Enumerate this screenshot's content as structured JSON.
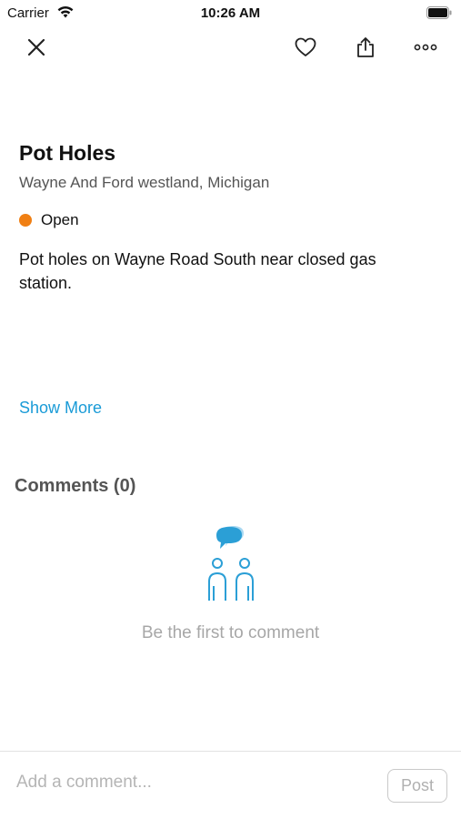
{
  "status_bar": {
    "carrier": "Carrier",
    "time": "10:26 AM",
    "icons": [
      "wifi-icon",
      "battery-icon"
    ]
  },
  "nav": {
    "icons": [
      "close-icon",
      "heart-icon",
      "share-icon",
      "more-icon"
    ]
  },
  "issue": {
    "title": "Pot Holes",
    "location": "Wayne And Ford westland, Michigan",
    "status": "Open",
    "status_color": "#f07f13",
    "description": "Pot holes on Wayne Road South near closed gas station.",
    "show_more_label": "Show More"
  },
  "comments": {
    "title": "Comments (0)",
    "empty_icon": "people-chat-icon",
    "empty_text": "Be the first to comment"
  },
  "composer": {
    "placeholder": "Add a comment...",
    "value": "",
    "post_label": "Post"
  },
  "colors": {
    "accent": "#1a9bd7",
    "illustration": "#2b9fd6",
    "status_open": "#f07f13"
  }
}
